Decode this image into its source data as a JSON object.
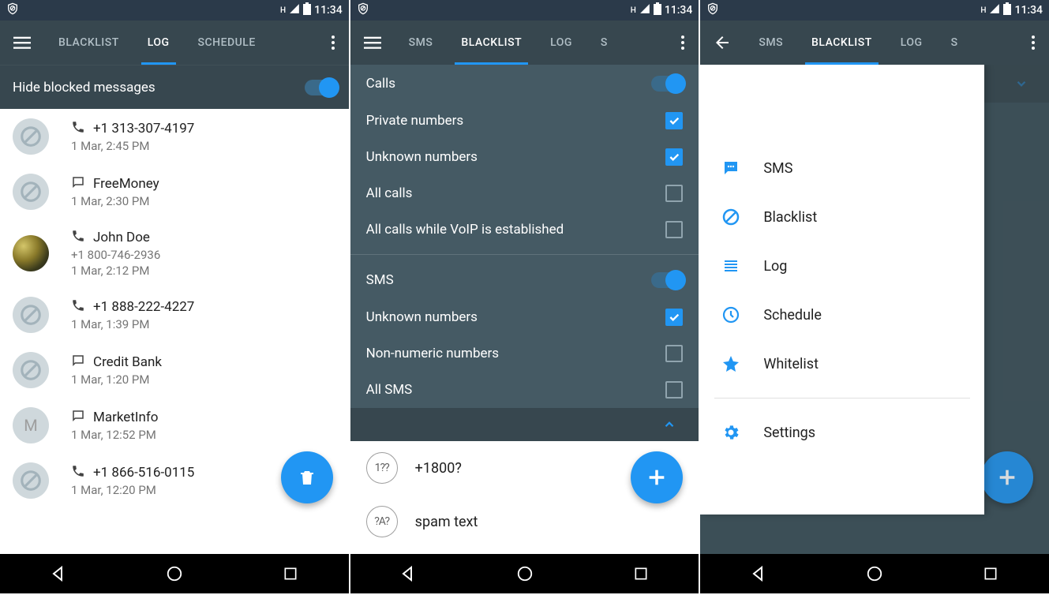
{
  "status": {
    "time": "11:34",
    "h_indicator": "H"
  },
  "screen1": {
    "tabs": [
      "BLACKLIST",
      "LOG",
      "SCHEDULE"
    ],
    "active_tab": 1,
    "toggle_label": "Hide blocked messages",
    "toggle_on": true,
    "entries": [
      {
        "icon": "call",
        "title": "+1 313-307-4197",
        "number": null,
        "time": "1 Mar, 2:45 PM",
        "avatar": "block"
      },
      {
        "icon": "sms",
        "title": "FreeMoney",
        "number": null,
        "time": "1 Mar, 2:30 PM",
        "avatar": "block"
      },
      {
        "icon": "call",
        "title": "John Doe",
        "number": "+1 800-746-2936",
        "time": "1 Mar, 2:12 PM",
        "avatar": "photo"
      },
      {
        "icon": "call",
        "title": "+1 888-222-4227",
        "number": null,
        "time": "1 Mar, 1:39 PM",
        "avatar": "block"
      },
      {
        "icon": "sms",
        "title": "Credit Bank",
        "number": null,
        "time": "1 Mar, 1:20 PM",
        "avatar": "block"
      },
      {
        "icon": "sms",
        "title": "MarketInfo",
        "number": null,
        "time": "1 Mar, 12:52 PM",
        "avatar": "letter"
      },
      {
        "icon": "call",
        "title": "+1 866-516-0115",
        "number": null,
        "time": "1 Mar, 12:20 PM",
        "avatar": "block"
      }
    ]
  },
  "screen2": {
    "tabs": [
      "SMS",
      "BLACKLIST",
      "LOG",
      "S"
    ],
    "active_tab": 1,
    "sections": [
      {
        "title": "Calls",
        "switch_on": true,
        "options": [
          {
            "label": "Private numbers",
            "checked": true
          },
          {
            "label": "Unknown numbers",
            "checked": true
          },
          {
            "label": "All calls",
            "checked": false
          },
          {
            "label": "All calls while VoIP is established",
            "checked": false
          }
        ]
      },
      {
        "title": "SMS",
        "switch_on": true,
        "options": [
          {
            "label": "Unknown numbers",
            "checked": true
          },
          {
            "label": "Non-numeric numbers",
            "checked": false
          },
          {
            "label": "All SMS",
            "checked": false
          }
        ]
      }
    ],
    "rules": [
      {
        "badge": "1??",
        "text": "+1800?"
      },
      {
        "badge": "?A?",
        "text": "spam text"
      }
    ]
  },
  "screen3": {
    "tabs": [
      "SMS",
      "BLACKLIST",
      "LOG",
      "S"
    ],
    "active_tab": 1,
    "drawer": {
      "items": [
        {
          "icon": "sms",
          "label": "SMS"
        },
        {
          "icon": "blacklist",
          "label": "Blacklist"
        },
        {
          "icon": "log",
          "label": "Log"
        },
        {
          "icon": "schedule",
          "label": "Schedule"
        },
        {
          "icon": "whitelist",
          "label": "Whitelist"
        }
      ],
      "settings_label": "Settings"
    }
  }
}
